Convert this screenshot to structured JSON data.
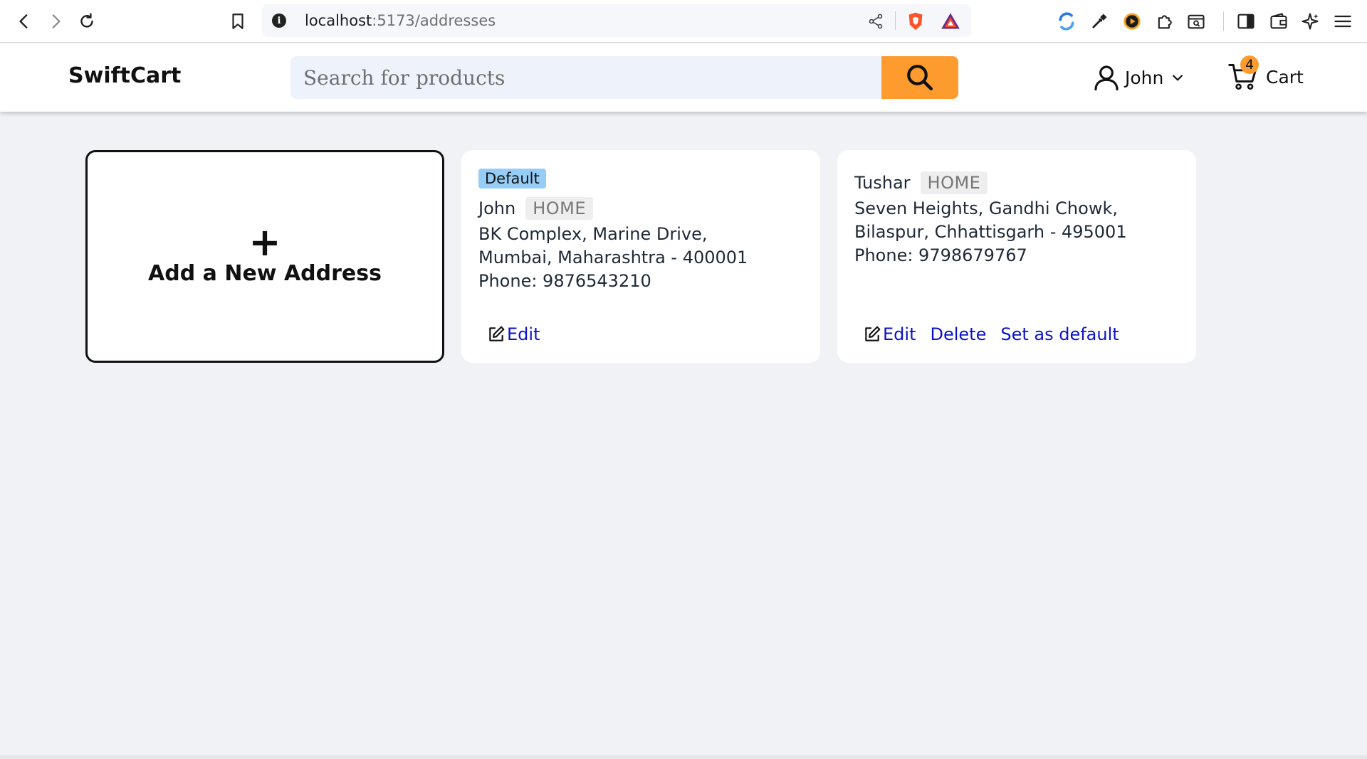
{
  "browser": {
    "url_host": "localhost",
    "url_path": ":5173/addresses",
    "info_glyph": "i"
  },
  "header": {
    "logo": "SwiftCart",
    "search_placeholder": "Search for products",
    "user_name": "John",
    "cart_count": "4",
    "cart_label": "Cart",
    "accent_color": "#fd9b2f"
  },
  "add_address": {
    "plus": "+",
    "label": "Add a New Address"
  },
  "addresses": [
    {
      "default_label": "Default",
      "name": "John",
      "type": "HOME",
      "line1": "BK Complex, Marine Drive,",
      "line2": "Mumbai, Maharashtra - 400001",
      "phone": "Phone: 9876543210",
      "edit_label": "Edit"
    },
    {
      "name": "Tushar",
      "type": "HOME",
      "line1": "Seven Heights, Gandhi Chowk,",
      "line2": "Bilaspur, Chhattisgarh - 495001",
      "phone": "Phone: 9798679767",
      "edit_label": "Edit",
      "delete_label": "Delete",
      "set_default_label": "Set as default"
    }
  ],
  "icons": {
    "back": "arrow-left-icon",
    "forward": "arrow-right-icon",
    "reload": "reload-icon",
    "bookmark": "bookmark-icon",
    "share": "share-icon",
    "search": "magnifier-icon",
    "user": "user-icon",
    "cart": "cart-icon",
    "edit": "edit-icon"
  }
}
